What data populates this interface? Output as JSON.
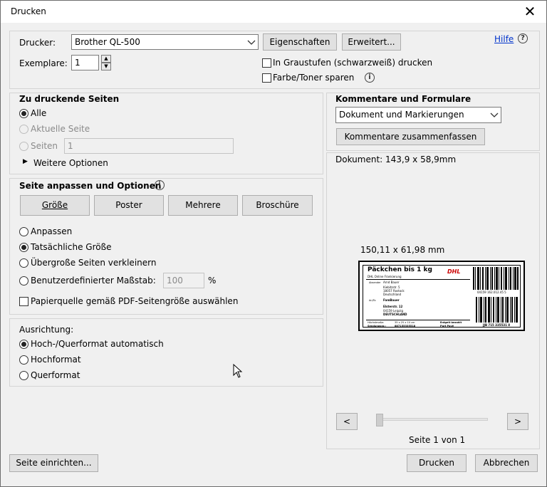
{
  "window": {
    "title": "Drucken"
  },
  "top": {
    "printer_label": "Drucker:",
    "printer_value": "Brother QL-500",
    "properties_btn": "Eigenschaften",
    "advanced_btn": "Erweitert...",
    "help_link": "Hilfe",
    "copies_label": "Exemplare:",
    "copies_value": "1",
    "grayscale_label": "In Graustufen (schwarzweiß) drucken",
    "save_toner_label": "Farbe/Toner sparen"
  },
  "pages": {
    "header": "Zu druckende Seiten",
    "all": "Alle",
    "current": "Aktuelle Seite",
    "pages": "Seiten",
    "pages_value": "1",
    "more": "Weitere Optionen"
  },
  "fit": {
    "header": "Seite anpassen und Optionen",
    "tabs": [
      "Größe",
      "Poster",
      "Mehrere",
      "Broschüre"
    ],
    "fit": "Anpassen",
    "actual": "Tatsächliche Größe",
    "shrink": "Übergroße Seiten verkleinern",
    "custom": "Benutzerdefinierter Maßstab:",
    "custom_value": "100",
    "percent": "%",
    "paper_source": "Papierquelle gemäß PDF-Seitengröße auswählen"
  },
  "orientation": {
    "header": "Ausrichtung:",
    "auto": "Hoch-/Querformat automatisch",
    "portrait": "Hochformat",
    "landscape": "Querformat"
  },
  "comments": {
    "header": "Kommentare und Formulare",
    "select_value": "Dokument und Markierungen",
    "summarize_btn": "Kommentare zusammenfassen"
  },
  "preview": {
    "document_size": "Dokument: 143,9 x 58,9mm",
    "paper_size": "150,11 x 61,98 mm",
    "page_info": "Seite 1 von 1",
    "prev": "<",
    "next": ">",
    "label": {
      "title": "Päckchen bis 1 kg",
      "brand": "DHL",
      "sub": "DHL Online Frankierung",
      "from_label": "Absender",
      "from_name": "Arnd Bauer",
      "from_street": "Kiebitzstr. 5",
      "from_city": "18057 Rostock",
      "from_country": "Deutschland",
      "to_label": "An/To",
      "to_name": "FamBauer",
      "to_street": "Elsterstr. 12",
      "to_city": "04159 Leipzig",
      "to_country": "DEUTSCHLAND",
      "barcode_top": "04159 162.012.45 5",
      "barcode_bottom": "JJB 715 335531 8",
      "weight_label": "Höchstmaße:",
      "weight_value": "35 x 25 x 10 cm",
      "paid": "Entgelt bezahlt",
      "paid2": "Port Payé",
      "tracking_label": "Sendungsnr.:",
      "tracking_value": "887155335518"
    }
  },
  "footer": {
    "page_setup_btn": "Seite einrichten...",
    "print_btn": "Drucken",
    "cancel_btn": "Abbrechen"
  }
}
